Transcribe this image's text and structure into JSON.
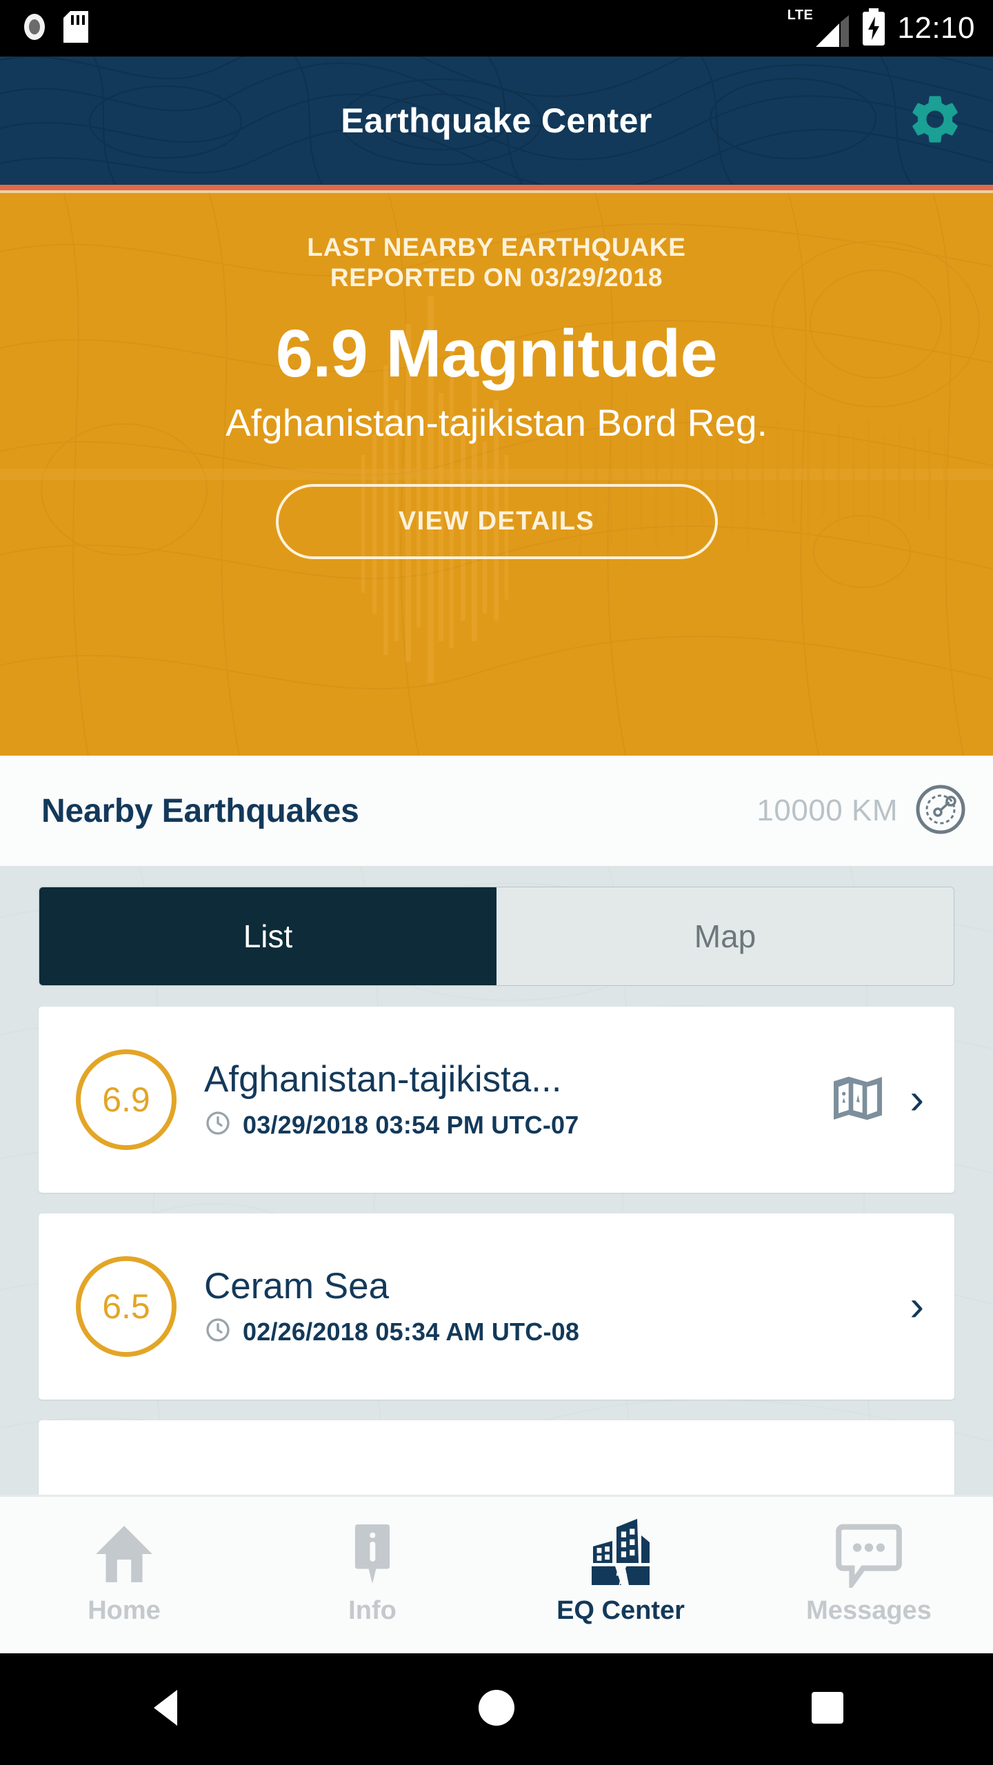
{
  "statusbar": {
    "time": "12:10",
    "network_label": "LTE",
    "icons": [
      "camera-icon",
      "sd-card-icon",
      "lte-signal-icon",
      "battery-charging-icon"
    ]
  },
  "header": {
    "title": "Earthquake Center",
    "settings_icon": "gear-icon",
    "bg_color": "#13395a",
    "accent_color": "#1aa095",
    "rule_color": "#e2694a"
  },
  "hero": {
    "kicker_line1": "LAST NEARBY EARTHQUAKE",
    "kicker_line2": "REPORTED ON 03/29/2018",
    "magnitude_headline": "6.9 Magnitude",
    "place": "Afghanistan-tajikistan Bord Reg.",
    "cta_label": "VIEW DETAILS",
    "bg_color": "#e09a19",
    "text_color": "#fdf2db"
  },
  "section": {
    "title": "Nearby Earthquakes",
    "radius_value": "10000 KM",
    "radius_icon": "radar-radius-icon"
  },
  "tabs": [
    {
      "label": "List",
      "active": true
    },
    {
      "label": "Map",
      "active": false
    }
  ],
  "list": [
    {
      "magnitude": "6.9",
      "title": "Afghanistan-tajikista...",
      "time_icon": "clock-icon",
      "datetime": "03/29/2018 03:54 PM UTC-07",
      "has_map_icon": true,
      "map_icon": "folded-map-icon",
      "chevron": "›"
    },
    {
      "magnitude": "6.5",
      "title": "Ceram Sea",
      "time_icon": "clock-icon",
      "datetime": "02/26/2018 05:34 AM UTC-08",
      "has_map_icon": false,
      "map_icon": "",
      "chevron": "›"
    }
  ],
  "bottom_nav": [
    {
      "label": "Home",
      "icon": "home-icon",
      "active": false
    },
    {
      "label": "Info",
      "icon": "info-pin-icon",
      "active": false
    },
    {
      "label": "EQ Center",
      "icon": "eq-building-icon",
      "active": true
    },
    {
      "label": "Messages",
      "icon": "message-icon",
      "active": false
    }
  ],
  "android_nav": {
    "back": "back-triangle-icon",
    "home": "home-circle-icon",
    "recents": "recents-square-icon"
  },
  "colors": {
    "navy": "#13395a",
    "orange": "#e09a19",
    "mag_orange": "#e3a526",
    "teal": "#1aa095",
    "page_bg": "#dde5e7",
    "tab_active_bg": "#0d2b38",
    "muted": "#c3c9cc"
  }
}
